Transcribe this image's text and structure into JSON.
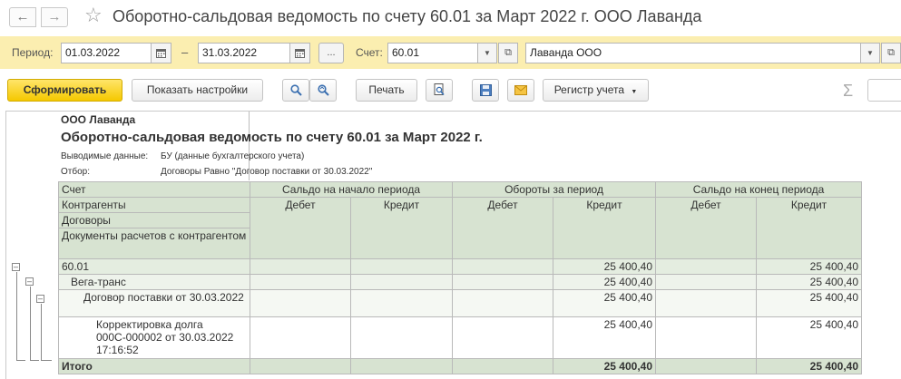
{
  "window": {
    "title": "Оборотно-сальдовая ведомость по счету 60.01 за Март 2022 г. ООО Лаванда"
  },
  "filters": {
    "period_label": "Период:",
    "date_from": "01.03.2022",
    "dash": "–",
    "date_to": "31.03.2022",
    "more_label": "...",
    "account_label": "Счет:",
    "account_value": "60.01",
    "org_value": "Лаванда ООО"
  },
  "toolbar": {
    "generate_label": "Сформировать",
    "settings_label": "Показать настройки",
    "print_label": "Печать",
    "register_label": "Регистр учета",
    "sum_symbol": "Σ"
  },
  "report": {
    "org": "ООО Лаванда",
    "title": "Оборотно-сальдовая ведомость по счету 60.01 за Март 2022 г.",
    "shown_data_label": "Выводимые данные:",
    "shown_data_value": "БУ (данные бухгалтерского учета)",
    "filter_label": "Отбор:",
    "filter_value": "Договоры Равно \"Договор поставки от 30.03.2022\"",
    "headers": {
      "account": "Счет",
      "counterparties": "Контрагенты",
      "contracts": "Договоры",
      "documents": "Документы расчетов с контрагентом",
      "opening": "Сальдо на начало периода",
      "turnover": "Обороты за период",
      "closing": "Сальдо на конец периода",
      "debit": "Дебет",
      "credit": "Кредит"
    },
    "rows": [
      {
        "name": "60.01",
        "open_d": "",
        "open_c": "",
        "turn_d": "",
        "turn_c": "25 400,40",
        "close_d": "",
        "close_c": "25 400,40"
      },
      {
        "name": "Вега-транс",
        "open_d": "",
        "open_c": "",
        "turn_d": "",
        "turn_c": "25 400,40",
        "close_d": "",
        "close_c": "25 400,40"
      },
      {
        "name": "Договор поставки от 30.03.2022",
        "open_d": "",
        "open_c": "",
        "turn_d": "",
        "turn_c": "25 400,40",
        "close_d": "",
        "close_c": "25 400,40"
      },
      {
        "name": "Корректировка долга 000С-000002 от 30.03.2022 17:16:52",
        "open_d": "",
        "open_c": "",
        "turn_d": "",
        "turn_c": "25 400,40",
        "close_d": "",
        "close_c": "25 400,40"
      }
    ],
    "total": {
      "name": "Итого",
      "turn_c": "25 400,40",
      "close_c": "25 400,40"
    }
  },
  "icons": {
    "back": "arrow-left-icon",
    "forward": "arrow-right-icon",
    "favorite": "star-icon",
    "calendar": "calendar-icon",
    "dropdown": "chevron-down-icon",
    "open": "open-window-icon",
    "search": "search-icon",
    "search_next": "search-next-icon",
    "preview": "print-preview-icon",
    "save": "save-icon",
    "mail": "mail-icon",
    "collapse": "collapse-icon"
  }
}
